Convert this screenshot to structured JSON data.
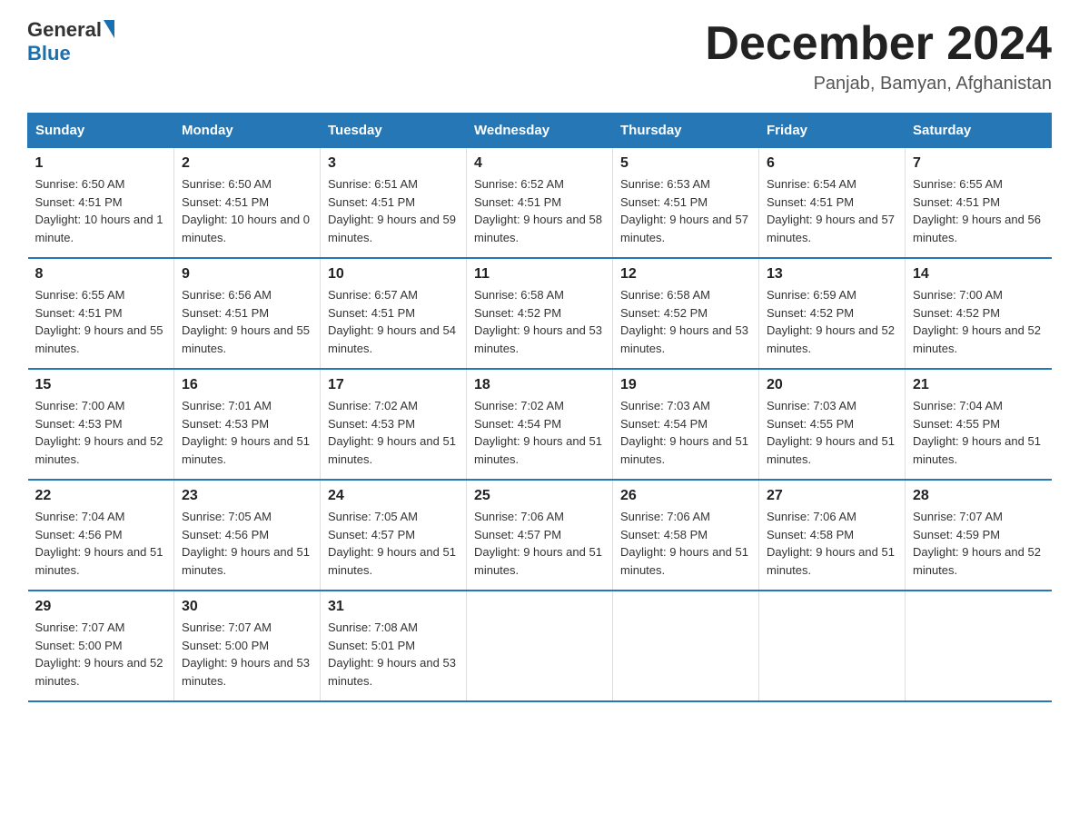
{
  "header": {
    "logo": {
      "general": "General",
      "blue": "Blue"
    },
    "title": "December 2024",
    "location": "Panjab, Bamyan, Afghanistan"
  },
  "days_of_week": [
    "Sunday",
    "Monday",
    "Tuesday",
    "Wednesday",
    "Thursday",
    "Friday",
    "Saturday"
  ],
  "weeks": [
    [
      {
        "day": "1",
        "sunrise": "6:50 AM",
        "sunset": "4:51 PM",
        "daylight": "10 hours and 1 minute."
      },
      {
        "day": "2",
        "sunrise": "6:50 AM",
        "sunset": "4:51 PM",
        "daylight": "10 hours and 0 minutes."
      },
      {
        "day": "3",
        "sunrise": "6:51 AM",
        "sunset": "4:51 PM",
        "daylight": "9 hours and 59 minutes."
      },
      {
        "day": "4",
        "sunrise": "6:52 AM",
        "sunset": "4:51 PM",
        "daylight": "9 hours and 58 minutes."
      },
      {
        "day": "5",
        "sunrise": "6:53 AM",
        "sunset": "4:51 PM",
        "daylight": "9 hours and 57 minutes."
      },
      {
        "day": "6",
        "sunrise": "6:54 AM",
        "sunset": "4:51 PM",
        "daylight": "9 hours and 57 minutes."
      },
      {
        "day": "7",
        "sunrise": "6:55 AM",
        "sunset": "4:51 PM",
        "daylight": "9 hours and 56 minutes."
      }
    ],
    [
      {
        "day": "8",
        "sunrise": "6:55 AM",
        "sunset": "4:51 PM",
        "daylight": "9 hours and 55 minutes."
      },
      {
        "day": "9",
        "sunrise": "6:56 AM",
        "sunset": "4:51 PM",
        "daylight": "9 hours and 55 minutes."
      },
      {
        "day": "10",
        "sunrise": "6:57 AM",
        "sunset": "4:51 PM",
        "daylight": "9 hours and 54 minutes."
      },
      {
        "day": "11",
        "sunrise": "6:58 AM",
        "sunset": "4:52 PM",
        "daylight": "9 hours and 53 minutes."
      },
      {
        "day": "12",
        "sunrise": "6:58 AM",
        "sunset": "4:52 PM",
        "daylight": "9 hours and 53 minutes."
      },
      {
        "day": "13",
        "sunrise": "6:59 AM",
        "sunset": "4:52 PM",
        "daylight": "9 hours and 52 minutes."
      },
      {
        "day": "14",
        "sunrise": "7:00 AM",
        "sunset": "4:52 PM",
        "daylight": "9 hours and 52 minutes."
      }
    ],
    [
      {
        "day": "15",
        "sunrise": "7:00 AM",
        "sunset": "4:53 PM",
        "daylight": "9 hours and 52 minutes."
      },
      {
        "day": "16",
        "sunrise": "7:01 AM",
        "sunset": "4:53 PM",
        "daylight": "9 hours and 51 minutes."
      },
      {
        "day": "17",
        "sunrise": "7:02 AM",
        "sunset": "4:53 PM",
        "daylight": "9 hours and 51 minutes."
      },
      {
        "day": "18",
        "sunrise": "7:02 AM",
        "sunset": "4:54 PM",
        "daylight": "9 hours and 51 minutes."
      },
      {
        "day": "19",
        "sunrise": "7:03 AM",
        "sunset": "4:54 PM",
        "daylight": "9 hours and 51 minutes."
      },
      {
        "day": "20",
        "sunrise": "7:03 AM",
        "sunset": "4:55 PM",
        "daylight": "9 hours and 51 minutes."
      },
      {
        "day": "21",
        "sunrise": "7:04 AM",
        "sunset": "4:55 PM",
        "daylight": "9 hours and 51 minutes."
      }
    ],
    [
      {
        "day": "22",
        "sunrise": "7:04 AM",
        "sunset": "4:56 PM",
        "daylight": "9 hours and 51 minutes."
      },
      {
        "day": "23",
        "sunrise": "7:05 AM",
        "sunset": "4:56 PM",
        "daylight": "9 hours and 51 minutes."
      },
      {
        "day": "24",
        "sunrise": "7:05 AM",
        "sunset": "4:57 PM",
        "daylight": "9 hours and 51 minutes."
      },
      {
        "day": "25",
        "sunrise": "7:06 AM",
        "sunset": "4:57 PM",
        "daylight": "9 hours and 51 minutes."
      },
      {
        "day": "26",
        "sunrise": "7:06 AM",
        "sunset": "4:58 PM",
        "daylight": "9 hours and 51 minutes."
      },
      {
        "day": "27",
        "sunrise": "7:06 AM",
        "sunset": "4:58 PM",
        "daylight": "9 hours and 51 minutes."
      },
      {
        "day": "28",
        "sunrise": "7:07 AM",
        "sunset": "4:59 PM",
        "daylight": "9 hours and 52 minutes."
      }
    ],
    [
      {
        "day": "29",
        "sunrise": "7:07 AM",
        "sunset": "5:00 PM",
        "daylight": "9 hours and 52 minutes."
      },
      {
        "day": "30",
        "sunrise": "7:07 AM",
        "sunset": "5:00 PM",
        "daylight": "9 hours and 53 minutes."
      },
      {
        "day": "31",
        "sunrise": "7:08 AM",
        "sunset": "5:01 PM",
        "daylight": "9 hours and 53 minutes."
      },
      null,
      null,
      null,
      null
    ]
  ]
}
